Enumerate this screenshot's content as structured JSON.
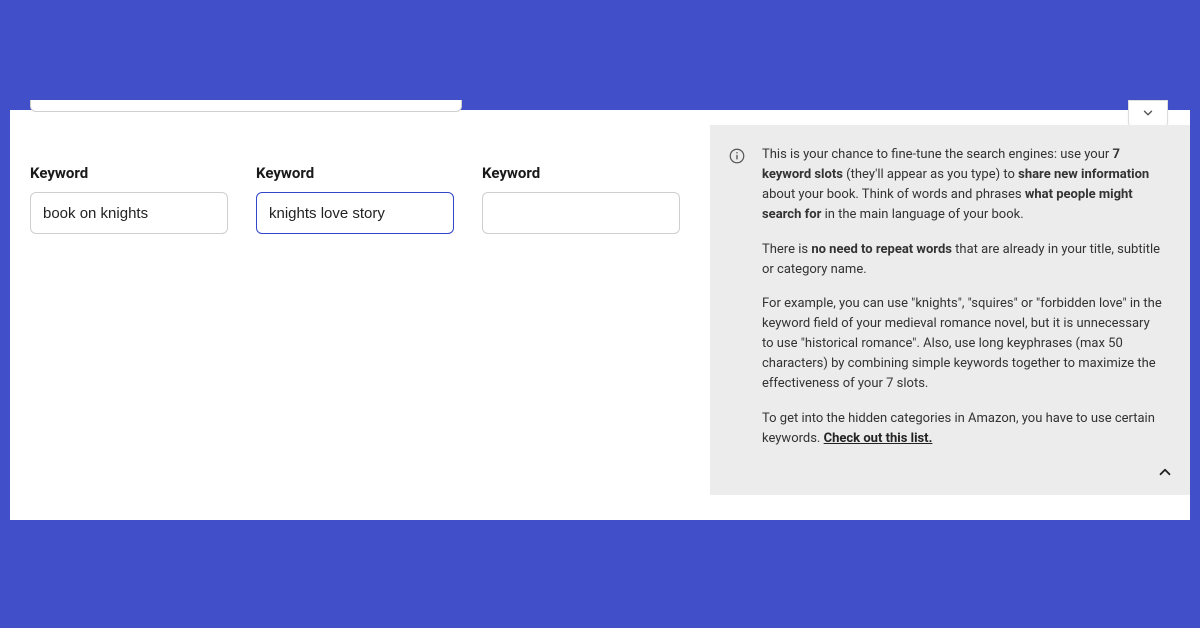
{
  "keywords": {
    "label": "Keyword",
    "fields": [
      {
        "value": "book on knights"
      },
      {
        "value": "knights love story"
      },
      {
        "value": ""
      }
    ]
  },
  "info": {
    "p1_a": "This is your chance to fine-tune the search engines: use your ",
    "p1_b_bold": "7 keyword slots",
    "p1_c": " (they'll appear as you type) to ",
    "p1_d_bold": "share new information",
    "p1_e": " about your book. Think of words and phrases ",
    "p1_f_bold": "what people might search for",
    "p1_g": " in the main language of your book.",
    "p2_a": "There is ",
    "p2_b_bold": "no need to repeat words",
    "p2_c": " that are already in your title, subtitle or category name.",
    "p3": "For example, you can use \"knights\", \"squires\" or \"forbidden love\" in the keyword field of your medieval romance novel, but it is unnecessary to use \"historical romance\". Also, use long keyphrases (max 50 characters) by combining simple keywords together to maximize the effectiveness of your 7 slots.",
    "p4_a": "To get into the hidden categories in Amazon, you have to use certain keywords. ",
    "p4_link": "Check out this list."
  }
}
